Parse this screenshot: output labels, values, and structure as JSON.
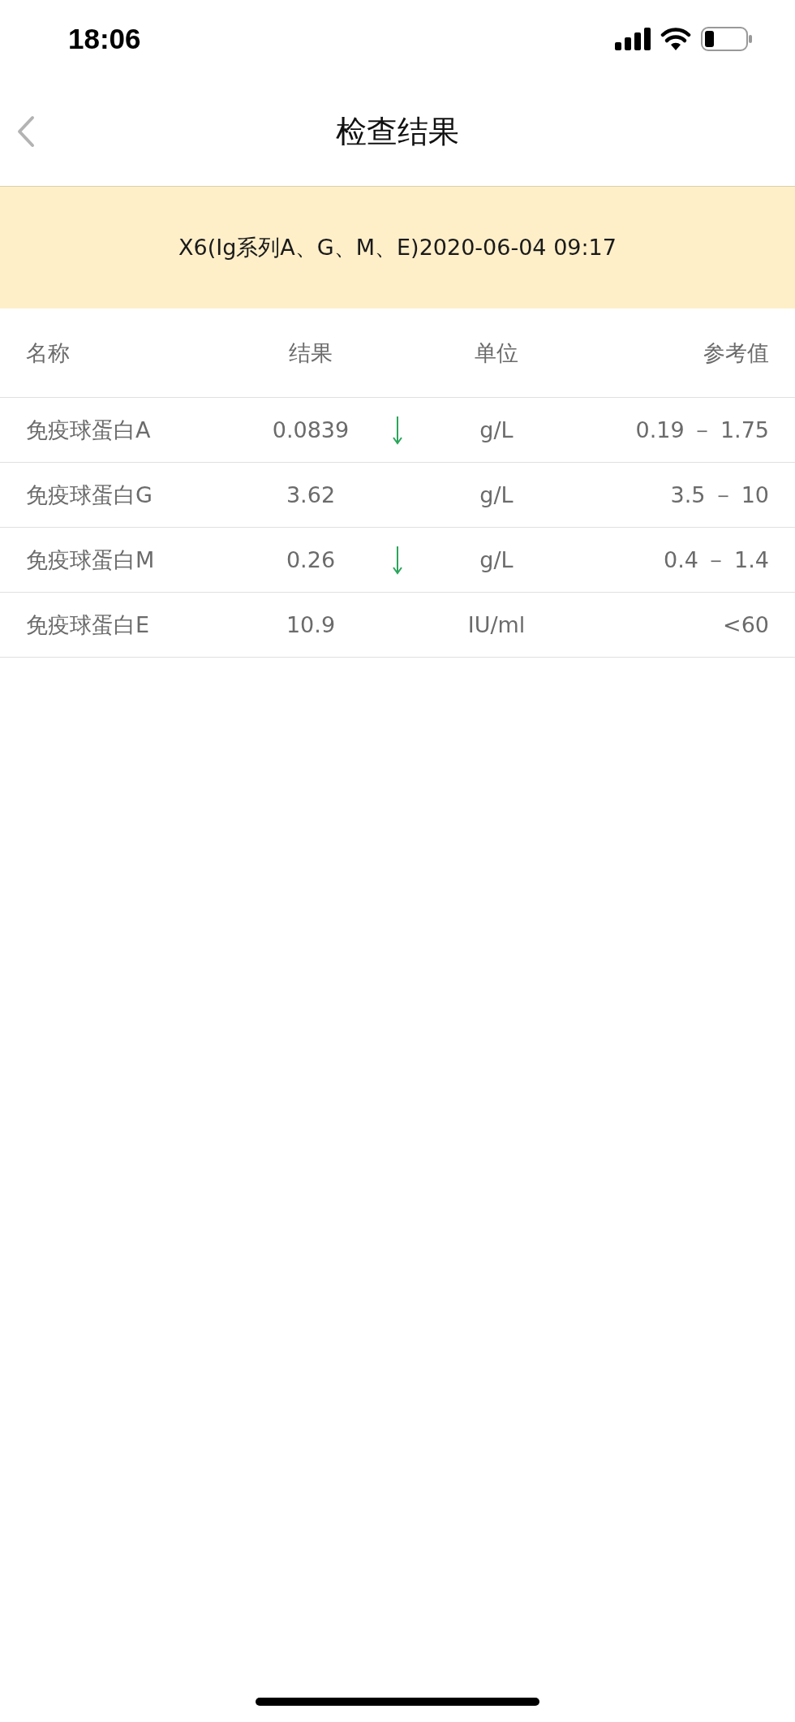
{
  "status_bar": {
    "time": "18:06"
  },
  "nav": {
    "title": "检查结果"
  },
  "banner": {
    "text": "X6(Ig系列A、G、M、E)2020-06-04 09:17"
  },
  "table": {
    "columns": [
      "名称",
      "结果",
      "单位",
      "参考值"
    ],
    "rows": [
      {
        "name": "免疫球蛋白A",
        "result": "0.0839",
        "low": true,
        "unit": "g/L",
        "reference": "0.19 － 1.75"
      },
      {
        "name": "免疫球蛋白G",
        "result": "3.62",
        "low": false,
        "unit": "g/L",
        "reference": "3.5 － 10"
      },
      {
        "name": "免疫球蛋白M",
        "result": "0.26",
        "low": true,
        "unit": "g/L",
        "reference": "0.4 － 1.4"
      },
      {
        "name": "免疫球蛋白E",
        "result": "10.9",
        "low": false,
        "unit": "IU/ml",
        "reference": "<60"
      }
    ]
  }
}
